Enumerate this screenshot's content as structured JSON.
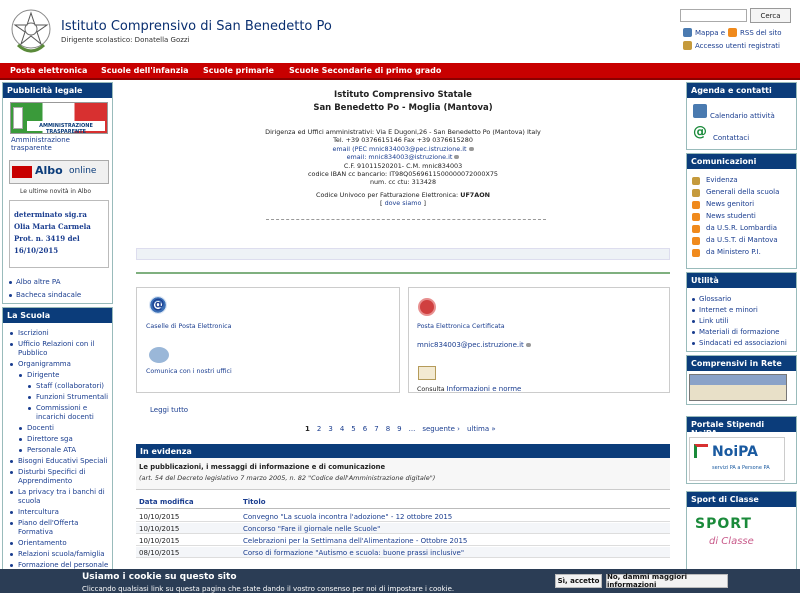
{
  "header": {
    "title": "Istituto Comprensivo di San Benedetto Po",
    "subtitle": "Dirigente scolastico: Donatella Gozzi",
    "search_button": "Cerca",
    "link_mappa": "Mappa e",
    "link_rss": "RSS del sito",
    "link_accesso": "Accesso utenti registrati"
  },
  "topnav": [
    "Posta elettronica",
    "Scuole dell'infanzia",
    "Scuole primarie",
    "Scuole Secondarie di primo grado"
  ],
  "left": {
    "pubblicita_title": "Pubblicità legale",
    "amm_banner": "AMMINISTRAZIONE TRASPARENTE",
    "amm_link": "Amministrazione trasparente",
    "albo_word": "Albo",
    "albo_online": "online",
    "albo_news": "Le ultime novità in Albo",
    "albo_item": "determinato sig.ra Olia Maria Carmela Prot. n. 3419 del 16/10/2015",
    "links": [
      "Albo altre PA",
      "Bacheca sindacale"
    ],
    "scuola_title": "La Scuola",
    "scuola_items": [
      {
        "label": "Iscrizioni",
        "level": 0
      },
      {
        "label": "Ufficio Relazioni con il Pubblico",
        "level": 0
      },
      {
        "label": "Organigramma",
        "level": 0
      },
      {
        "label": "Dirigente",
        "level": 1
      },
      {
        "label": "Staff (collaboratori)",
        "level": 2
      },
      {
        "label": "Funzioni Strumentali",
        "level": 2
      },
      {
        "label": "Commissioni e incarichi docenti",
        "level": 2
      },
      {
        "label": "Docenti",
        "level": 1
      },
      {
        "label": "Direttore sga",
        "level": 1
      },
      {
        "label": "Personale ATA",
        "level": 1
      },
      {
        "label": "Bisogni Educativi Speciali",
        "level": 0
      },
      {
        "label": "Disturbi Specifici di Apprendimento",
        "level": 0
      },
      {
        "label": "La privacy tra i banchi di scuola",
        "level": 0
      },
      {
        "label": "Intercultura",
        "level": 0
      },
      {
        "label": "Piano dell'Offerta Formativa",
        "level": 0
      },
      {
        "label": "Orientamento",
        "level": 0
      },
      {
        "label": "Relazioni scuola/famiglia",
        "level": 0
      },
      {
        "label": "Formazione del personale",
        "level": 0
      }
    ]
  },
  "center": {
    "school_name": "Istituto Comprensivo Statale",
    "school_place": "San Benedetto Po - Moglia (Mantova)",
    "info_lines": [
      "Dirigenza ed Uffici amministrativi: Via E Dugoni,26 - San Benedetto Po (Mantova) Italy",
      "Tel. +39 0376615146 Fax +39 0376615280",
      "email (PEC mnic834003@pec.istruzione.it",
      "email: mnic834003@istruzione.it",
      "C.F. 91011520201- C.M. mnic834003",
      "codice IBAN cc bancario: IT98Q0569611500000072000X75",
      "num. cc ctu: 313428"
    ],
    "fatturazione_label": "Codice Univoco per Fatturazione Elettronica:",
    "fatturazione_code": "UF7AON",
    "dove_siamo": "dove siamo",
    "caselle": "Caselle di Posta Elettronica",
    "pec_title": "Posta Elettronica Certificata",
    "pec_email": "mnic834003@pec.istruzione.it",
    "comunica": "Comunica con i nostri uffici",
    "consulta": "Consulta",
    "info_norme": "Informazioni e norme",
    "leggi_tutto": "Leggi tutto",
    "pages": [
      "1",
      "2",
      "3",
      "4",
      "5",
      "6",
      "7",
      "8",
      "9",
      "...",
      "seguente ›",
      "ultima »"
    ],
    "evidenza_title": "In evidenza",
    "evidenza_desc": "Le pubblicazioni, i messaggi di informazione e di comunicazione",
    "evidenza_sub": "(art. 54 del Decreto legislativo 7 marzo 2005, n. 82 \"Codice dell'Amministrazione digitale\")",
    "col_date": "Data modifica",
    "col_title": "Titolo",
    "rows": [
      {
        "date": "10/10/2015",
        "title": "Convegno \"La scuola incontra l'adozione\" - 12 ottobre 2015"
      },
      {
        "date": "10/10/2015",
        "title": "Concorso \"Fare il giornale nelle Scuole\""
      },
      {
        "date": "10/10/2015",
        "title": "Celebrazioni per la Settimana dell'Alimentazione - Ottobre 2015"
      },
      {
        "date": "08/10/2015",
        "title": "Corso di formazione \"Autismo e scuola: buone prassi inclusive\""
      }
    ]
  },
  "right": {
    "agenda_title": "Agenda e contatti",
    "calendario": "Calendario attività",
    "contattaci": "Contattaci",
    "comunicazioni_title": "Comunicazioni",
    "com_items": [
      "Evidenza",
      "Generali della scuola",
      "News genitori",
      "News studenti",
      "da U.S.R. Lombardia",
      "da U.S.T. di Mantova",
      "da Ministero P.I."
    ],
    "utilita_title": "Utilità",
    "util_items": [
      "Glossario",
      "Internet e minori",
      "Link utili",
      "Materiali di formazione",
      "Sindacati ed associazioni"
    ],
    "comprensivi_title": "Comprensivi in Rete",
    "stipendi_title": "Portale Stipendi NoiPA",
    "noipa_logo": "NoiPA",
    "noipa_tagline": "servizi PA a Persone PA",
    "sport_title": "Sport di Classe",
    "sport_word": "SPORT",
    "sport_sub": "di Classe"
  },
  "cookie": {
    "title": "Usiamo i cookie su questo sito",
    "text": "Cliccando qualsiasi link su questa pagina che state dando il vostro consenso per noi di impostare i cookie.",
    "accept": "Sì, accetto",
    "decline": "No, dammi maggiori informazioni"
  },
  "colors": {
    "nav_red": "#c80000",
    "box_blue": "#0b3c7a",
    "link": "#1a3d8f",
    "cookie_bg": "#2b3d55"
  }
}
